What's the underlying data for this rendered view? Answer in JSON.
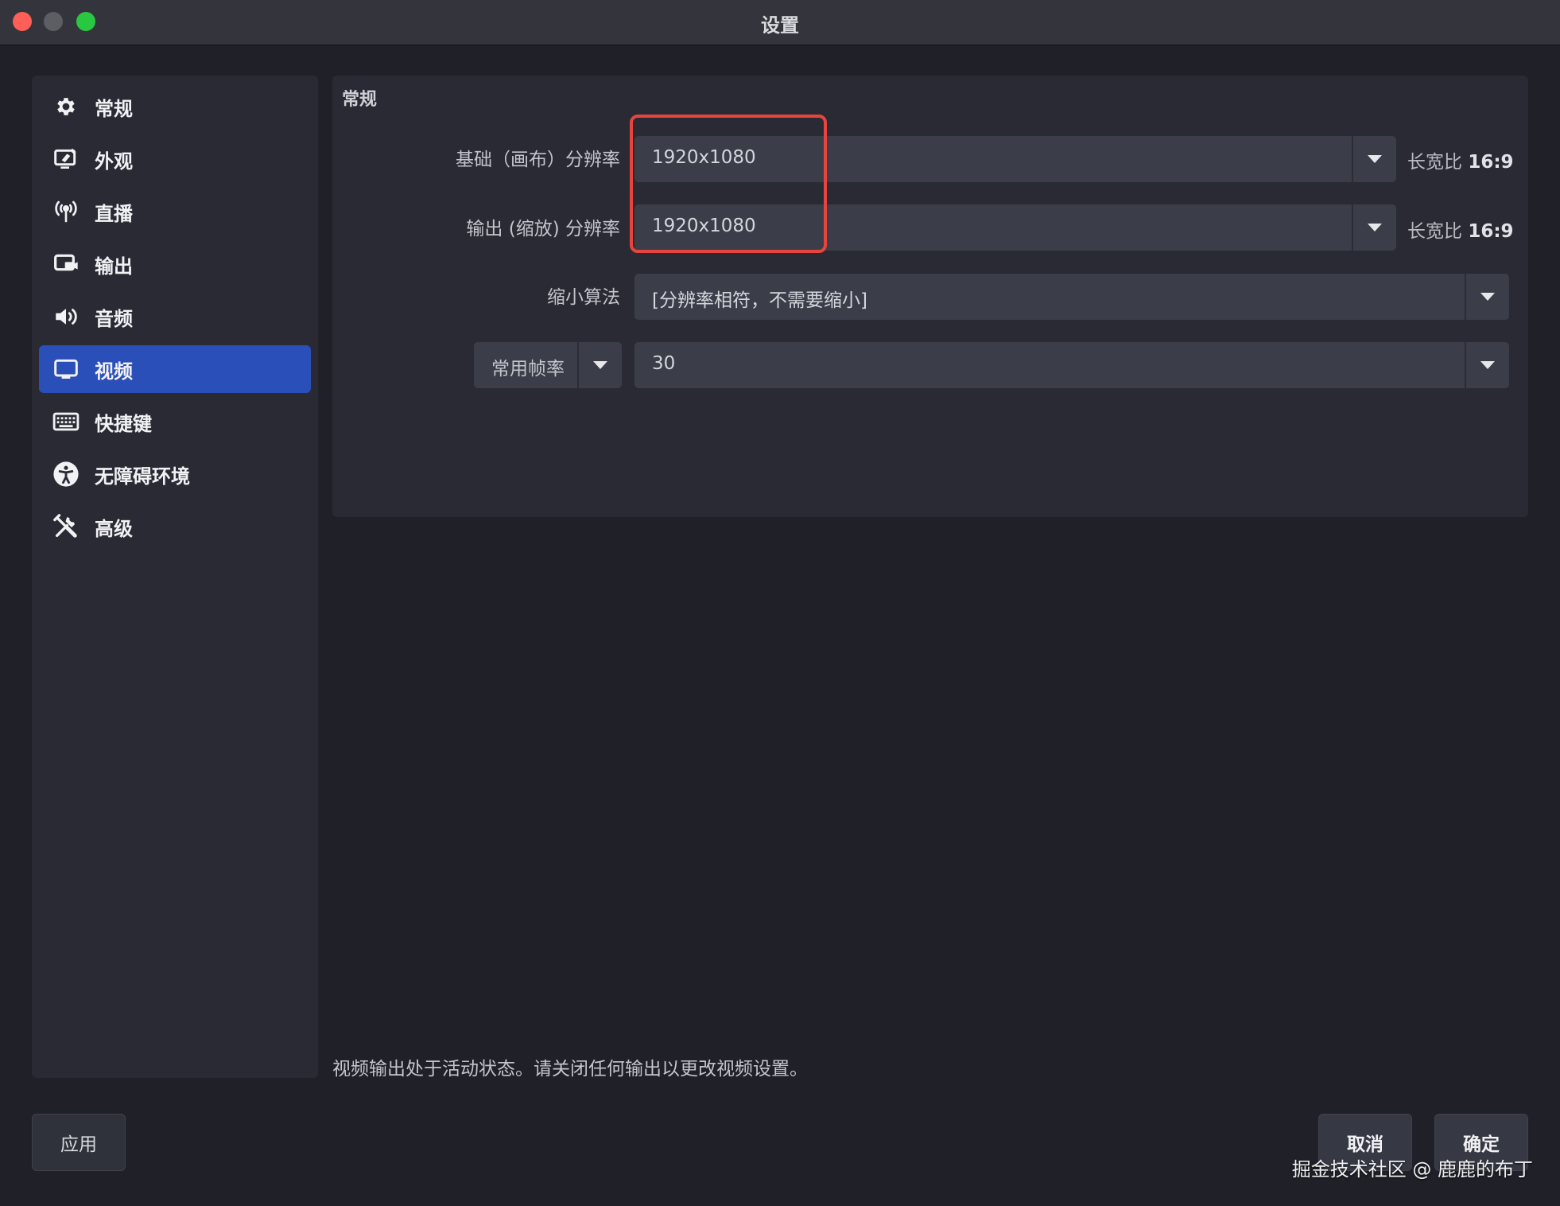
{
  "window": {
    "title": "设置"
  },
  "sidebar": {
    "items": [
      {
        "label": "常规",
        "icon": "gear-icon",
        "active": false
      },
      {
        "label": "外观",
        "icon": "appearance-icon",
        "active": false
      },
      {
        "label": "直播",
        "icon": "broadcast-antenna-icon",
        "active": false
      },
      {
        "label": "输出",
        "icon": "output-icon",
        "active": false
      },
      {
        "label": "音频",
        "icon": "speaker-icon",
        "active": false
      },
      {
        "label": "视频",
        "icon": "monitor-icon",
        "active": true
      },
      {
        "label": "快捷键",
        "icon": "keyboard-icon",
        "active": false
      },
      {
        "label": "无障碍环境",
        "icon": "accessibility-icon",
        "active": false
      },
      {
        "label": "高级",
        "icon": "tools-icon",
        "active": false
      }
    ]
  },
  "video": {
    "group_title": "常规",
    "base_resolution": {
      "label": "基础（画布）分辨率",
      "value": "1920x1080",
      "aspect_prefix": "长宽比",
      "aspect_value": "16:9"
    },
    "output_resolution": {
      "label": "输出 (缩放) 分辨率",
      "value": "1920x1080",
      "aspect_prefix": "长宽比",
      "aspect_value": "16:9"
    },
    "downscale_filter": {
      "label": "缩小算法",
      "value": "[分辨率相符，不需要缩小]"
    },
    "fps": {
      "type_label": "常用帧率",
      "value": "30"
    }
  },
  "status_message": "视频输出处于活动状态。请关闭任何输出以更改视频设置。",
  "buttons": {
    "apply": "应用",
    "cancel": "取消",
    "ok": "确定"
  },
  "watermark": "掘金技术社区 @ 鹿鹿的布丁",
  "colors": {
    "accent": "#2b4fb8",
    "highlight": "#e8443e",
    "background": "#1f2028",
    "panel": "#292a33"
  }
}
